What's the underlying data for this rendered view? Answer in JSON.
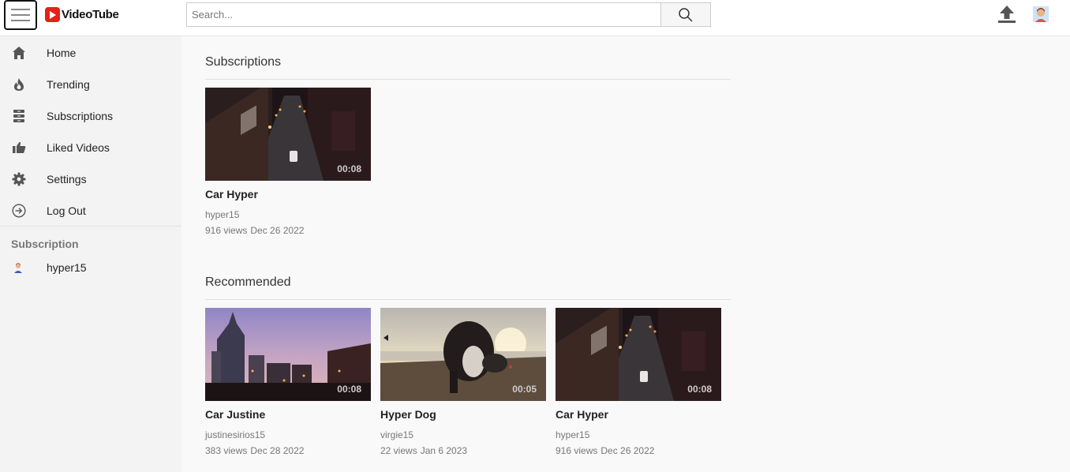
{
  "app": {
    "name": "VideoTube"
  },
  "search": {
    "placeholder": "Search..."
  },
  "sidebar": {
    "items": [
      {
        "label": "Home",
        "icon": "home-icon"
      },
      {
        "label": "Trending",
        "icon": "flame-icon"
      },
      {
        "label": "Subscriptions",
        "icon": "subscriptions-icon"
      },
      {
        "label": "Liked Videos",
        "icon": "thumbs-up-icon"
      },
      {
        "label": "Settings",
        "icon": "gear-icon"
      },
      {
        "label": "Log Out",
        "icon": "logout-icon"
      }
    ],
    "subscription_heading": "Subscription",
    "subscriptions": [
      {
        "name": "hyper15"
      }
    ]
  },
  "main": {
    "subscriptions_title": "Subscriptions",
    "recommended_title": "Recommended",
    "subscriptions_videos": [
      {
        "title": "Car Hyper",
        "channel": "hyper15",
        "views": "916 views",
        "date": "Dec 26 2022",
        "duration": "00:08",
        "thumb": "city-street-night"
      }
    ],
    "recommended_videos": [
      {
        "title": "Car Justine",
        "channel": "justinesirios15",
        "views": "383 views",
        "date": "Dec 28 2022",
        "duration": "00:08",
        "thumb": "city-skyline-dusk"
      },
      {
        "title": "Hyper Dog",
        "channel": "virgie15",
        "views": "22 views",
        "date": "Jan 6 2023",
        "duration": "00:05",
        "thumb": "dog-beach-sunset"
      },
      {
        "title": "Car Hyper",
        "channel": "hyper15",
        "views": "916 views",
        "date": "Dec 26 2022",
        "duration": "00:08",
        "thumb": "city-street-night"
      }
    ]
  },
  "colors": {
    "brand": "#e62117",
    "background": "#f9f9f9",
    "sidebar": "#f3f3f3"
  }
}
